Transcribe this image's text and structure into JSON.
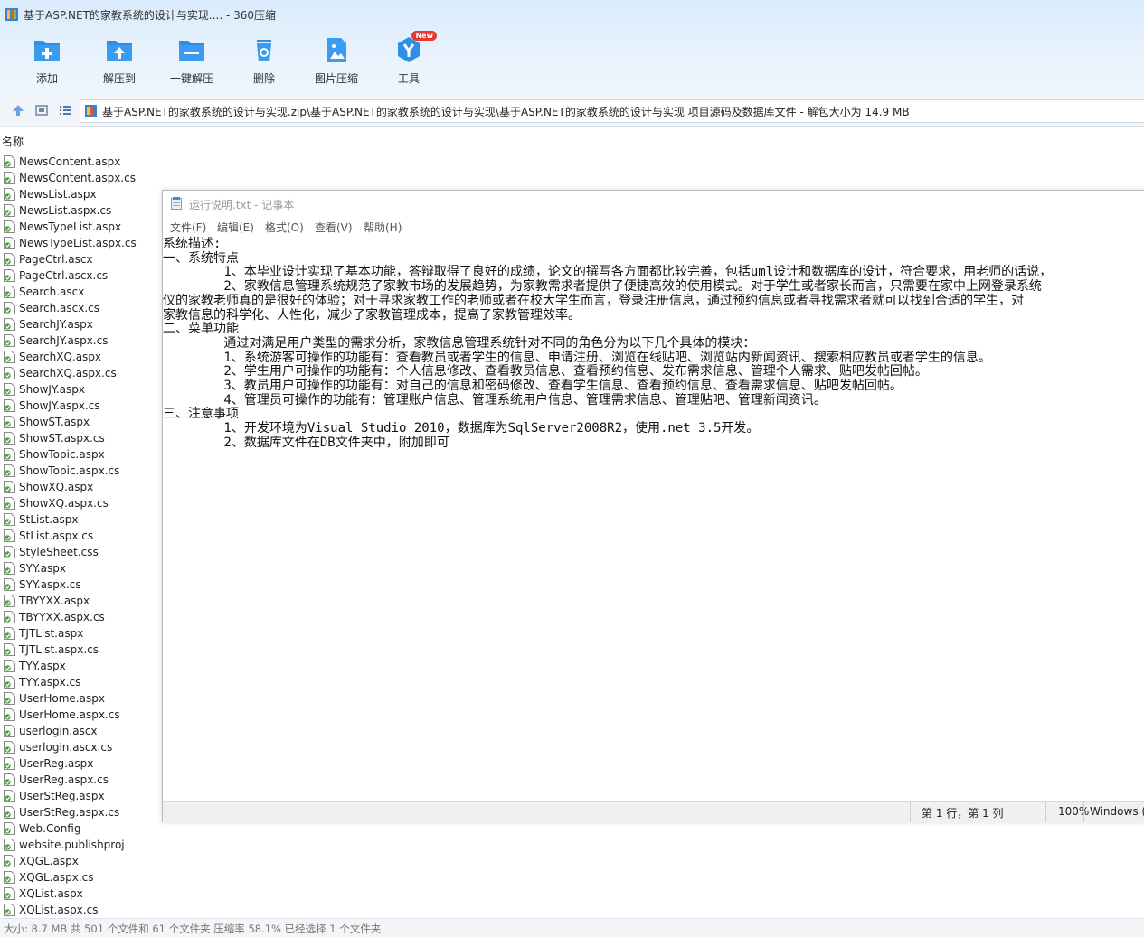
{
  "window": {
    "title": "基于ASP.NET的家教系统的设计与实现.... - 360压缩"
  },
  "toolbar": {
    "items": [
      {
        "label": "添加",
        "icon": "add-icon"
      },
      {
        "label": "解压到",
        "icon": "extract-to-icon"
      },
      {
        "label": "一键解压",
        "icon": "one-click-extract-icon"
      },
      {
        "label": "删除",
        "icon": "delete-icon"
      },
      {
        "label": "图片压缩",
        "icon": "image-compress-icon"
      },
      {
        "label": "工具",
        "icon": "tools-icon",
        "badge": "New"
      }
    ]
  },
  "address": {
    "path": "基于ASP.NET的家教系统的设计与实现.zip\\基于ASP.NET的家教系统的设计与实现\\基于ASP.NET的家教系统的设计与实现 项目源码及数据库文件 - 解包大小为 14.9 MB"
  },
  "columns": {
    "name": "名称"
  },
  "files": [
    "NewsContent.aspx",
    "NewsContent.aspx.cs",
    "NewsList.aspx",
    "NewsList.aspx.cs",
    "NewsTypeList.aspx",
    "NewsTypeList.aspx.cs",
    "PageCtrl.ascx",
    "PageCtrl.ascx.cs",
    "Search.ascx",
    "Search.ascx.cs",
    "SearchJY.aspx",
    "SearchJY.aspx.cs",
    "SearchXQ.aspx",
    "SearchXQ.aspx.cs",
    "ShowJY.aspx",
    "ShowJY.aspx.cs",
    "ShowST.aspx",
    "ShowST.aspx.cs",
    "ShowTopic.aspx",
    "ShowTopic.aspx.cs",
    "ShowXQ.aspx",
    "ShowXQ.aspx.cs",
    "StList.aspx",
    "StList.aspx.cs",
    "StyleSheet.css",
    "SYY.aspx",
    "SYY.aspx.cs",
    "TBYYXX.aspx",
    "TBYYXX.aspx.cs",
    "TJTList.aspx",
    "TJTList.aspx.cs",
    "TYY.aspx",
    "TYY.aspx.cs",
    "UserHome.aspx",
    "UserHome.aspx.cs",
    "userlogin.ascx",
    "userlogin.ascx.cs",
    "UserReg.aspx",
    "UserReg.aspx.cs",
    "UserStReg.aspx",
    "UserStReg.aspx.cs",
    "Web.Config",
    "website.publishproj",
    "XQGL.aspx",
    "XQGL.aspx.cs",
    "XQList.aspx",
    "XQList.aspx.cs"
  ],
  "status": {
    "text": "大小: 8.7 MB 共 501 个文件和 61 个文件夹 压缩率 58.1% 已经选择 1 个文件夹"
  },
  "notepad": {
    "title": "运行说明.txt - 记事本",
    "menu": [
      "文件(F)",
      "编辑(E)",
      "格式(O)",
      "查看(V)",
      "帮助(H)"
    ],
    "lines": [
      "系统描述:",
      "一、系统特点",
      "        1、本毕业设计实现了基本功能，答辩取得了良好的成绩，论文的撰写各方面都比较完善，包括uml设计和数据库的设计，符合要求，用老师的话说，",
      "        2、家教信息管理系统规范了家教市场的发展趋势，为家教需求者提供了便捷高效的使用模式。对于学生或者家长而言，只需要在家中上网登录系统",
      "仪的家教老师真的是很好的体验；对于寻求家教工作的老师或者在校大学生而言，登录注册信息，通过预约信息或者寻找需求者就可以找到合适的学生，对",
      "家教信息的科学化、人性化，减少了家教管理成本，提高了家教管理效率。",
      "二、菜单功能",
      "        通过对满足用户类型的需求分析，家教信息管理系统针对不同的角色分为以下几个具体的模块：",
      "        1、系统游客可操作的功能有：查看教员或者学生的信息、申请注册、浏览在线贴吧、浏览站内新闻资讯、搜索相应教员或者学生的信息。",
      "        2、学生用户可操作的功能有：个人信息修改、查看教员信息、查看预约信息、发布需求信息、管理个人需求、贴吧发帖回帖。",
      "        3、教员用户可操作的功能有：对自己的信息和密码修改、查看学生信息、查看预约信息、查看需求信息、贴吧发帖回帖。",
      "        4、管理员可操作的功能有：管理账户信息、管理系统用户信息、管理需求信息、管理贴吧、管理新闻资讯。",
      "三、注意事项",
      "        1、开发环境为Visual Studio 2010，数据库为SqlServer2008R2，使用.net 3.5开发。",
      "        2、数据库文件在DB文件夹中，附加即可"
    ],
    "status": {
      "position": "第 1 行，第 1 列",
      "zoom": "100%",
      "encoding": "Windows ("
    }
  }
}
